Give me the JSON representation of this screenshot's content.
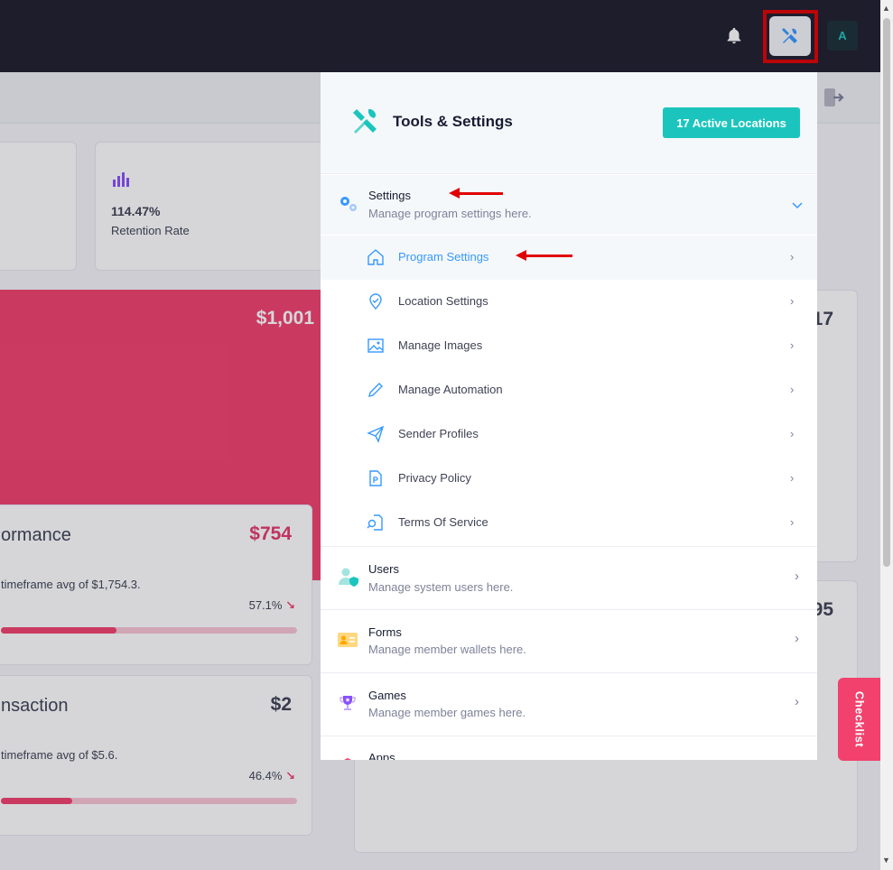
{
  "topbar": {
    "avatar_initial": "A"
  },
  "stats": [
    {
      "value": "114.47%",
      "label": "Retention Rate"
    }
  ],
  "pink_card": {
    "value": "$1,001"
  },
  "perf_cards": [
    {
      "title": "ormance",
      "amount": "$754",
      "sub": "timeframe avg of $1,754.3.",
      "pct": "57.1%",
      "trend": "↘",
      "progress": 0.39
    },
    {
      "title": "nsaction",
      "amount": "$2",
      "sub": "timeframe avg of $5.6.",
      "pct": "46.4%",
      "trend": "↘",
      "progress": 0.24
    }
  ],
  "right_partial": {
    "a": "17",
    "b": "95"
  },
  "checklist": "Checklist",
  "panel": {
    "title": "Tools & Settings",
    "badge": "17 Active Locations",
    "settings": {
      "title": "Settings",
      "desc": "Manage program settings here.",
      "items": [
        {
          "label": "Program Settings",
          "icon": "home-icon"
        },
        {
          "label": "Location Settings",
          "icon": "location-pin-icon"
        },
        {
          "label": "Manage Images",
          "icon": "image-icon"
        },
        {
          "label": "Manage Automation",
          "icon": "pencil-icon"
        },
        {
          "label": "Sender Profiles",
          "icon": "paper-plane-icon"
        },
        {
          "label": "Privacy Policy",
          "icon": "document-p-icon"
        },
        {
          "label": "Terms Of Service",
          "icon": "document-search-icon"
        }
      ]
    },
    "sections": [
      {
        "title": "Users",
        "desc": "Manage system users here."
      },
      {
        "title": "Forms",
        "desc": "Manage member wallets here."
      },
      {
        "title": "Games",
        "desc": "Manage member games here."
      },
      {
        "title": "Apps",
        "desc": ""
      }
    ]
  },
  "colors": {
    "accent": "#1bc5bd",
    "danger": "#f1416c",
    "primary": "#3699ff",
    "dark": "#1e1e2d"
  }
}
